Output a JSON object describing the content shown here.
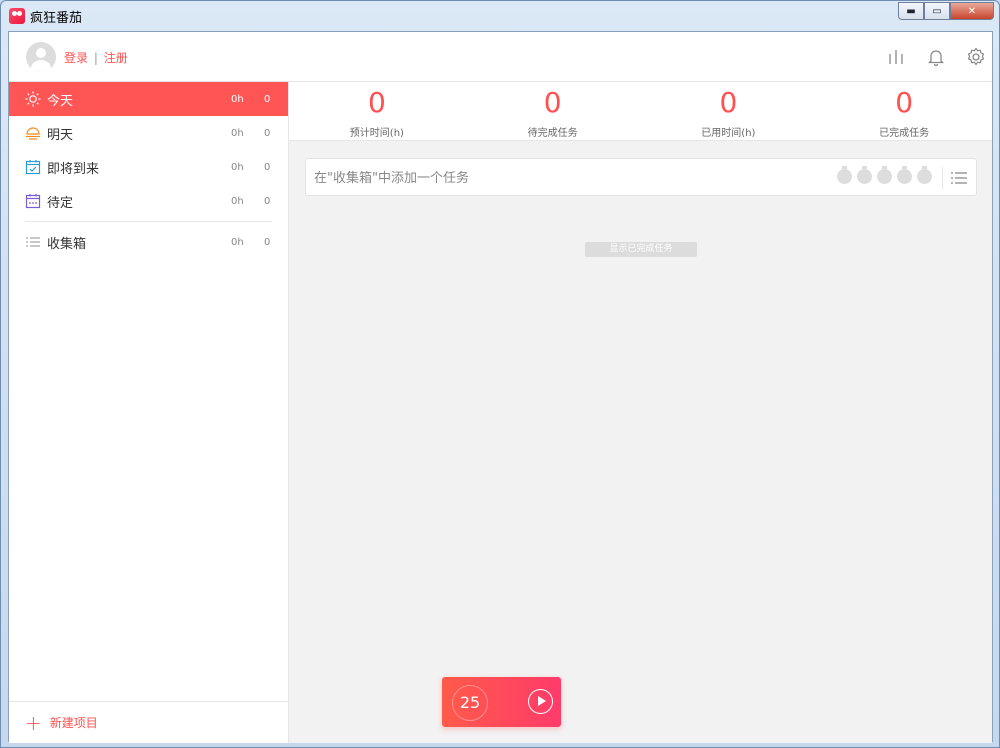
{
  "window": {
    "title": "疯狂番茄",
    "minimize_glyph": "▬",
    "maximize_glyph": "▭",
    "close_glyph": "✕"
  },
  "header": {
    "login_label": "登录",
    "separator": "|",
    "register_label": "注册",
    "icons": [
      "statistics-icon",
      "bell-icon",
      "gear-icon"
    ]
  },
  "sidebar": {
    "items": [
      {
        "label": "今天",
        "hours": "0h",
        "count": "0",
        "icon": "sun-icon",
        "active": true
      },
      {
        "label": "明天",
        "hours": "0h",
        "count": "0",
        "icon": "sunrise-icon",
        "active": false
      },
      {
        "label": "即将到来",
        "hours": "0h",
        "count": "0",
        "icon": "calendar-check-icon",
        "active": false
      },
      {
        "label": "待定",
        "hours": "0h",
        "count": "0",
        "icon": "calendar-dots-icon",
        "active": false
      }
    ],
    "inbox": {
      "label": "收集箱",
      "hours": "0h",
      "count": "0",
      "icon": "list-icon"
    },
    "new_project_label": "新建项目"
  },
  "stats": [
    {
      "value": "0",
      "label": "预计时间(h)"
    },
    {
      "value": "0",
      "label": "待完成任务"
    },
    {
      "value": "0",
      "label": "已用时间(h)"
    },
    {
      "value": "0",
      "label": "已完成任务"
    }
  ],
  "add_task": {
    "placeholder": "在\"收集箱\"中添加一个任务",
    "pomodoro_count": 5
  },
  "show_completed_label": "显示已完成任务",
  "timer": {
    "minutes": "25"
  },
  "colors": {
    "accent": "#ff5555",
    "icon_gray": "#888888"
  }
}
